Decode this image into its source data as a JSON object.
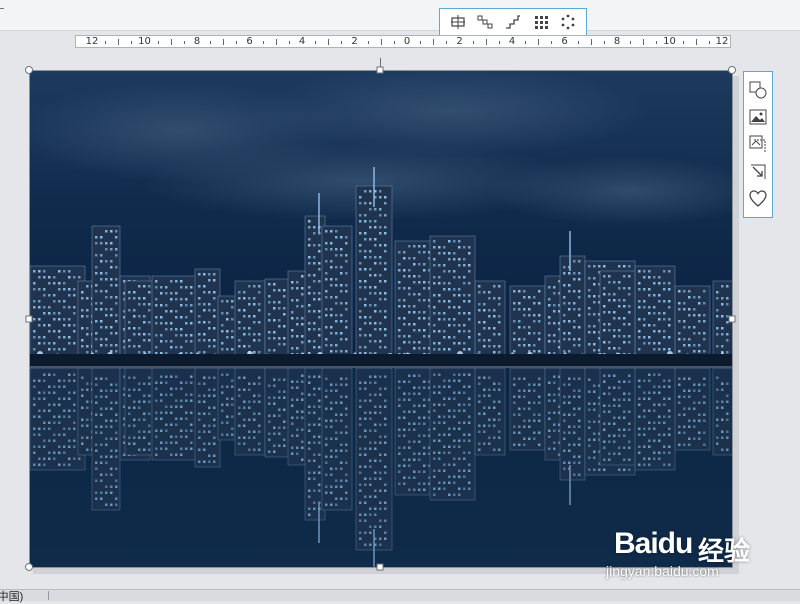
{
  "ruler": {
    "labels": [
      "12",
      "10",
      "8",
      "6",
      "4",
      "2",
      "0",
      "2",
      "4",
      "6",
      "8",
      "10",
      "12"
    ]
  },
  "float_toolbar": {
    "buttons": [
      {
        "icon": "align-center-icon"
      },
      {
        "icon": "step-down-icon"
      },
      {
        "icon": "step-up-icon"
      },
      {
        "icon": "grid-icon"
      },
      {
        "icon": "circle-dots-icon"
      }
    ]
  },
  "side_panel": {
    "buttons": [
      {
        "icon": "shape-icon"
      },
      {
        "icon": "picture-icon"
      },
      {
        "icon": "crop-icon"
      },
      {
        "icon": "resize-icon"
      },
      {
        "icon": "heart-icon"
      }
    ]
  },
  "image": {
    "subject": "night city skyline with water reflection",
    "colors": {
      "sky": "#0f2a48",
      "water": "#0b1e35",
      "lights": "#9fd6ff"
    }
  },
  "watermark": {
    "logo": "Baidu",
    "cn": "经验",
    "url": "jingyan.baidu.com"
  },
  "status": {
    "language": "(中国)"
  }
}
